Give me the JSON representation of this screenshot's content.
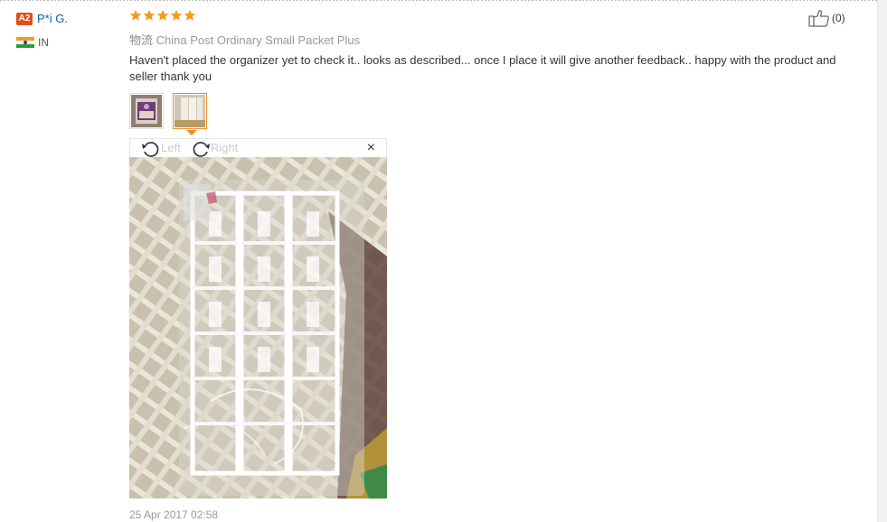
{
  "review": {
    "user": {
      "level": "A2",
      "name": "P*i G.",
      "country": "IN"
    },
    "rating": 5,
    "helpful": {
      "count": "(0)"
    },
    "shipping": {
      "prefix": "物流",
      "method": "China Post Ordinary Small Packet Plus"
    },
    "text": "Haven't placed the organizer yet to check it.. looks as described... once I place it will give another feedback.. happy with the product and seller thank you",
    "viewer": {
      "rotate_left": "Left",
      "rotate_right": "Right",
      "close": "×"
    },
    "date": "25 Apr 2017 02:58"
  },
  "colors": {
    "accent": "#f08a24",
    "link": "#0c5fa8",
    "badge": "#e04e1a",
    "star": "#f59b1c"
  }
}
